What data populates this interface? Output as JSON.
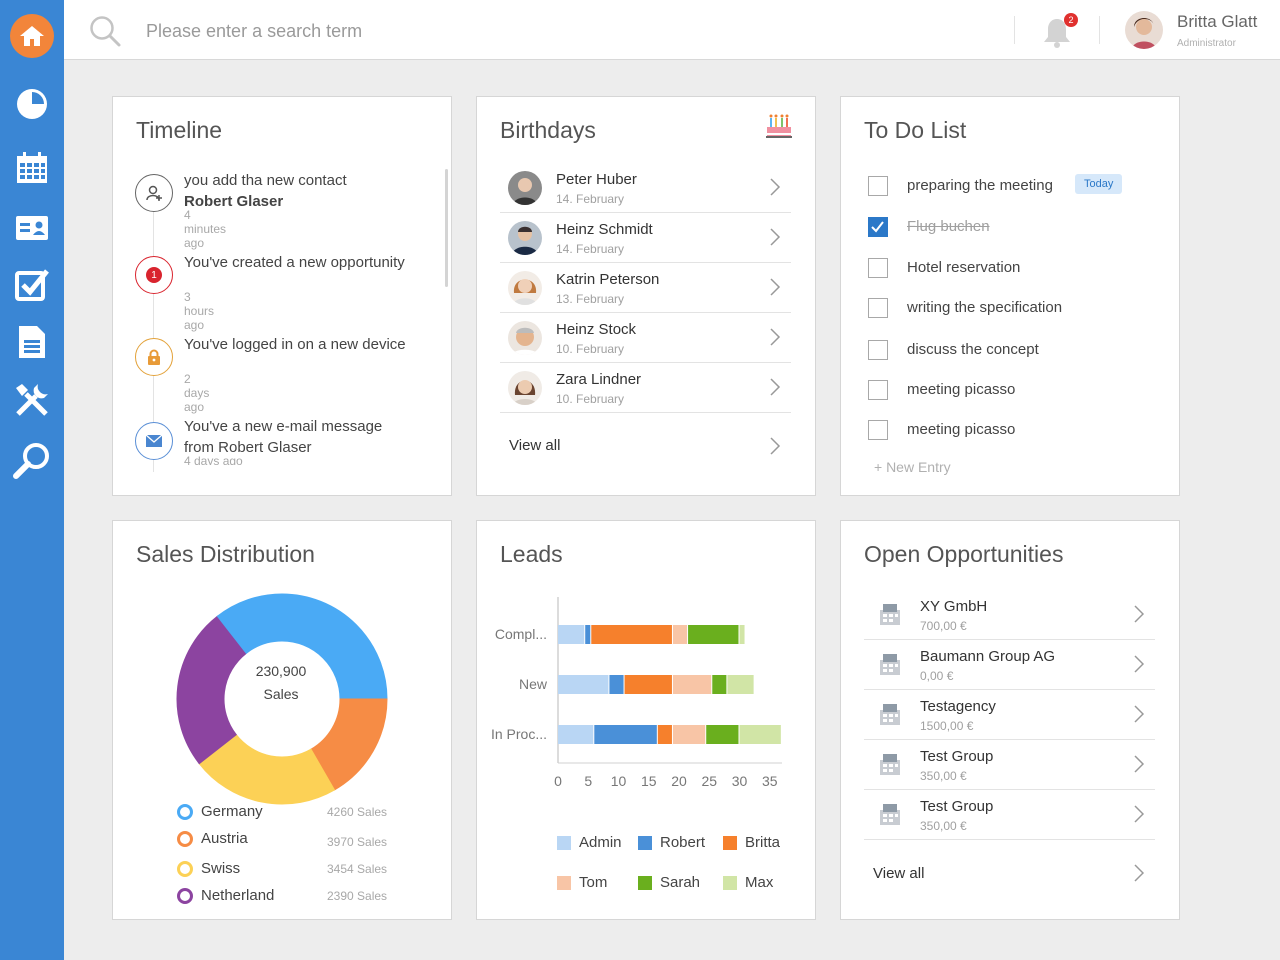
{
  "search": {
    "placeholder": "Please enter a search term"
  },
  "notifications": {
    "count": "2"
  },
  "user": {
    "name": "Britta Glatt",
    "role": "Administrator"
  },
  "timeline": {
    "title": "Timeline",
    "items": [
      {
        "text": "you add tha new contact",
        "bold": "Robert Glaser",
        "time": "4 minutes ago"
      },
      {
        "text": "You've created a new opportunity",
        "bold": "",
        "time": "3 hours ago",
        "badge": "1"
      },
      {
        "text": "You've logged in on a new device",
        "bold": "",
        "time": "2 days ago"
      },
      {
        "text": "You've a new e-mail message from Robert Glaser",
        "bold": "",
        "time": "4 days ago"
      }
    ]
  },
  "birthdays": {
    "title": "Birthdays",
    "items": [
      {
        "name": "Peter Huber",
        "date": "14. February"
      },
      {
        "name": "Heinz Schmidt",
        "date": "14. February"
      },
      {
        "name": "Katrin Peterson",
        "date": "13. February"
      },
      {
        "name": "Heinz Stock",
        "date": "10. February"
      },
      {
        "name": "Zara Lindner",
        "date": "10. February"
      }
    ],
    "view_all": "View all"
  },
  "todo": {
    "title": "To Do List",
    "items": [
      {
        "label": "preparing the meeting",
        "checked": false,
        "badge": "Today"
      },
      {
        "label": "Flug buchen",
        "checked": true
      },
      {
        "label": "Hotel reservation",
        "checked": false
      },
      {
        "label": "writing the specification",
        "checked": false
      },
      {
        "label": "discuss the concept",
        "checked": false
      },
      {
        "label": "meeting picasso",
        "checked": false
      },
      {
        "label": "meeting picasso",
        "checked": false
      }
    ],
    "new_entry": "+ New Entry"
  },
  "sales": {
    "title": "Sales Distribution",
    "total": "230,900",
    "total_label": "Sales",
    "legend": [
      {
        "label": "Germany",
        "value": "4260 Sales",
        "color": "#4aaaf5"
      },
      {
        "label": "Austria",
        "value": "3970 Sales",
        "color": "#f68c45"
      },
      {
        "label": "Swiss",
        "value": "3454 Sales",
        "color": "#fcd156"
      },
      {
        "label": "Netherland",
        "value": "2390 Sales",
        "color": "#8c44a0"
      }
    ]
  },
  "leads": {
    "title": "Leads",
    "chart_data": {
      "type": "bar",
      "orientation": "horizontal",
      "stacked": true,
      "categories": [
        "Compl...",
        "New",
        "In Proc..."
      ],
      "series": [
        {
          "name": "Admin",
          "color": "#b9d6f4",
          "values": [
            4.5,
            8.5,
            6
          ]
        },
        {
          "name": "Robert",
          "color": "#4a90d8",
          "values": [
            1,
            2.5,
            10.5
          ]
        },
        {
          "name": "Britta",
          "color": "#f6802c",
          "values": [
            13.5,
            8,
            2.5
          ]
        },
        {
          "name": "Tom",
          "color": "#f8c5a6",
          "values": [
            2.5,
            6.5,
            5.5
          ]
        },
        {
          "name": "Sarah",
          "color": "#6aaf1e",
          "values": [
            8.5,
            2.5,
            5.5
          ]
        },
        {
          "name": "Max",
          "color": "#d1e5a6",
          "values": [
            1,
            4.5,
            7
          ]
        }
      ],
      "xlim": [
        0,
        37
      ],
      "xticks": [
        "0",
        "5",
        "10",
        "15",
        "20",
        "25",
        "30",
        "35"
      ]
    }
  },
  "opportunities": {
    "title": "Open Opportunities",
    "items": [
      {
        "name": "XY GmbH",
        "value": "700,00 €"
      },
      {
        "name": "Baumann Group AG",
        "value": "0,00 €"
      },
      {
        "name": "Testagency",
        "value": "1500,00 €"
      },
      {
        "name": "Test Group",
        "value": "350,00 €"
      },
      {
        "name": "Test Group",
        "value": "350,00 €"
      }
    ],
    "view_all": "View all"
  }
}
